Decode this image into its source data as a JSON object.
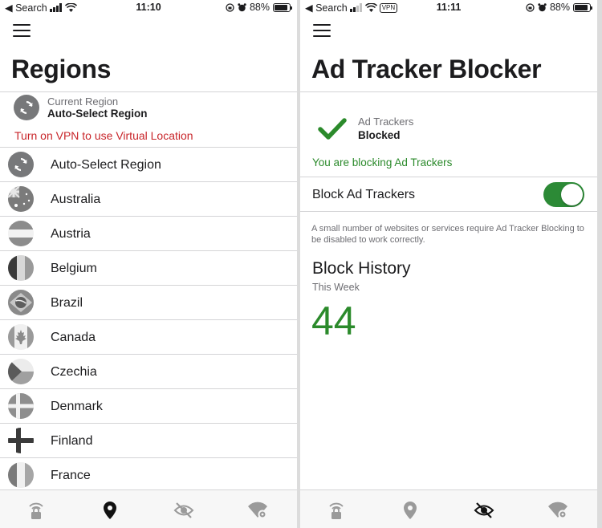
{
  "left_screen": {
    "status": {
      "back_label": "◀ Search",
      "time": "11:10",
      "battery": "88%",
      "battery_level": 0.88
    },
    "title": "Regions",
    "current_region": {
      "label": "Current Region",
      "value": "Auto-Select Region",
      "icon": "refresh-icon"
    },
    "warning": "Turn on VPN to use Virtual Location",
    "regions": [
      {
        "name": "Auto-Select Region",
        "icon": "refresh-icon"
      },
      {
        "name": "Australia",
        "icon": "australia-flag-icon"
      },
      {
        "name": "Austria",
        "icon": "austria-flag-icon"
      },
      {
        "name": "Belgium",
        "icon": "belgium-flag-icon"
      },
      {
        "name": "Brazil",
        "icon": "brazil-flag-icon"
      },
      {
        "name": "Canada",
        "icon": "canada-flag-icon"
      },
      {
        "name": "Czechia",
        "icon": "czechia-flag-icon"
      },
      {
        "name": "Denmark",
        "icon": "denmark-flag-icon"
      },
      {
        "name": "Finland",
        "icon": "finland-flag-icon"
      },
      {
        "name": "France",
        "icon": "france-flag-icon"
      }
    ],
    "tabs": [
      {
        "icon": "vpn-lock-icon",
        "active": false
      },
      {
        "icon": "location-pin-icon",
        "active": true
      },
      {
        "icon": "eye-slash-icon",
        "active": false
      },
      {
        "icon": "wifi-gear-icon",
        "active": false
      }
    ]
  },
  "right_screen": {
    "status": {
      "back_label": "◀ Search",
      "vpn_badge": "VPN",
      "time": "11:11",
      "battery": "88%",
      "battery_level": 0.88
    },
    "title": "Ad Tracker Blocker",
    "tracker_status": {
      "label": "Ad Trackers",
      "value": "Blocked",
      "icon": "checkmark-icon"
    },
    "message": "You are blocking Ad Trackers",
    "toggle": {
      "label": "Block Ad Trackers",
      "on": true
    },
    "note": "A small number of websites or services require Ad Tracker Blocking to be disabled to work correctly.",
    "history": {
      "title": "Block History",
      "period": "This Week",
      "count": "44"
    },
    "tabs": [
      {
        "icon": "vpn-lock-icon",
        "active": false
      },
      {
        "icon": "location-pin-icon",
        "active": false
      },
      {
        "icon": "eye-slash-icon",
        "active": true
      },
      {
        "icon": "wifi-gear-icon",
        "active": false
      }
    ]
  },
  "colors": {
    "green": "#2b8a2b",
    "toggle_green": "#2c8a36",
    "warning_red": "#c8252a",
    "active_tab": "#111111",
    "inactive_tab": "#9a9a9a"
  }
}
